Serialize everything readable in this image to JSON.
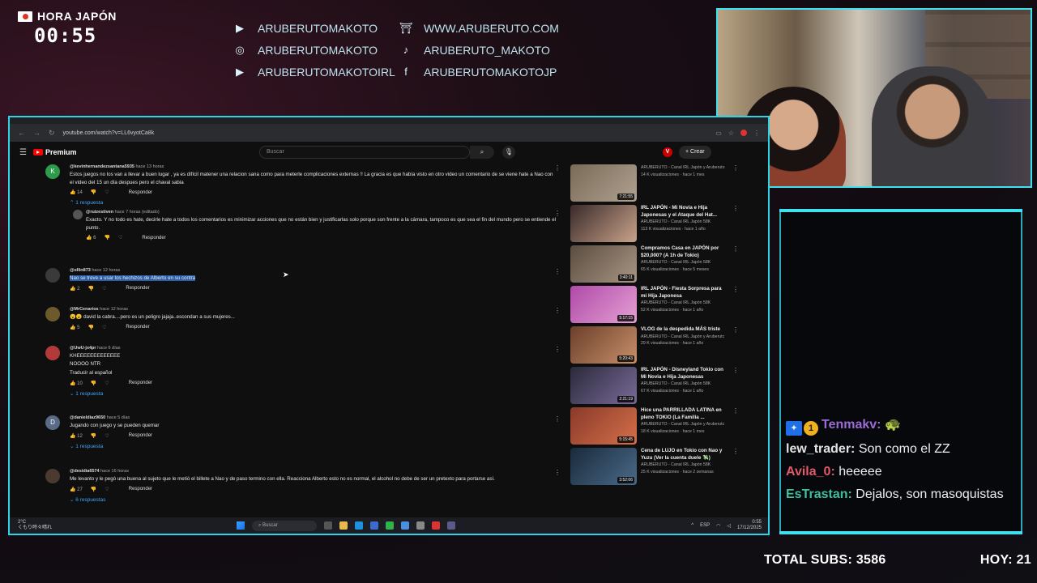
{
  "overlay": {
    "hora_label": "HORA JAPÓN",
    "hora_time": "00:55",
    "socials": [
      {
        "icon": "youtube-icon",
        "glyph": "▶",
        "text": "ARUBERUTOMAKOTO"
      },
      {
        "icon": "torii-icon",
        "glyph": "⛩",
        "text": "WWW.ARUBERUTO.COM"
      },
      {
        "icon": "instagram-icon",
        "glyph": "◎",
        "text": "ARUBERUTOMAKOTO"
      },
      {
        "icon": "tiktok-icon",
        "glyph": "♪",
        "text": "ARUBERUTO_MAKOTO"
      },
      {
        "icon": "youtube-icon",
        "glyph": "▶",
        "text": "ARUBERUTOMAKOTOIRL"
      },
      {
        "icon": "facebook-icon",
        "glyph": "f",
        "text": "ARUBERUTOMAKOTOJP"
      }
    ],
    "stats": {
      "total_subs": "TOTAL SUBS: 3586",
      "hoy": "HOY: 21"
    }
  },
  "chat": [
    {
      "user": "Tenmakv:",
      "color": "#9b6bd6",
      "message": "🐢",
      "badges": true
    },
    {
      "user": "lew_trader:",
      "color": "#e3e3e3",
      "message": "Son como el ZZ",
      "badges": false
    },
    {
      "user": "Avila_0:",
      "color": "#e05a6a",
      "message": "heeeee",
      "badges": false
    },
    {
      "user": "EsTrastan:",
      "color": "#3fbfa0",
      "message": "Dejalos, son masoquistas",
      "badges": false
    }
  ],
  "browser": {
    "url": "youtube.com/watch?v=LL6vyotCa8k"
  },
  "youtube": {
    "logo": "Premium",
    "search_placeholder": "Buscar",
    "create_label": "Crear",
    "v_badge": "V",
    "comments": [
      {
        "author": "@kevinhernandezsantana5935",
        "time": "hace 13 horas",
        "avatar": "K",
        "avatar_color": "#2e9a4c",
        "text": "Estos juegos no los van a llevar a buen lugar , ya es difícil matener una relacion sana como para meterle complicaciones externas !! La gracia es que había visto en otro video un comentario de se viene hate a Nao con el video del 15 un día despues pero el chaval sabia",
        "likes": "14",
        "reply_label": "Responder",
        "replies": "1 respuesta"
      },
      {
        "author": "@ruizestiven",
        "time": "hace 7 horas (editado)",
        "avatar": "",
        "avatar_color": "#555",
        "text": "Exacto. Y no todo es hate, decirle hate a todos los comentarios es minimizar acciones que no están bien y justificarlas solo porque son frente a la cámara, tampoco es que sea el fin del mundo pero se entiende el punto.",
        "likes": "6",
        "reply_label": "Responder",
        "replies": ""
      },
      {
        "author": "@ollin873",
        "time": "hace 12 horas",
        "avatar": "",
        "avatar_color": "#3a3a3a",
        "text": "Nao se treve a usar los hechizos de Alberto en su contra",
        "likes": "2",
        "reply_label": "Responder",
        "replies": ""
      },
      {
        "author": "@MrCenarios",
        "time": "hace 12 horas",
        "avatar": "",
        "avatar_color": "#6d5a2c",
        "text": "😮😮 david la cabra....pero es un peligro jajaja..escondan a sus mujeres...",
        "likes": "5",
        "reply_label": "Responder",
        "replies": ""
      },
      {
        "author": "@UwU-jx4pr",
        "time": "hace 6 días",
        "avatar": "",
        "avatar_color": "#b23a3a",
        "text": "KHEEEEEEEEEEEEE\nNOOOO NTR",
        "translate": "Traducir al español",
        "likes": "10",
        "reply_label": "Responder",
        "replies": "1 respuesta"
      },
      {
        "author": "@danieldiaz9650",
        "time": "hace 5 días",
        "avatar": "D",
        "avatar_color": "#5a6b85",
        "text": "Jugando con juego y se pueden quemar",
        "likes": "12",
        "reply_label": "Responder",
        "replies": "1 respuesta"
      },
      {
        "author": "@desidia6574",
        "time": "hace 16 horas",
        "avatar": "",
        "avatar_color": "#4a3a30",
        "text": "Me levanto y le pegó una buena al sujeto que le metió el billete a Nao y de paso termino con ella. Reacciona Alberto esto no es normal, el alcohol no debe de ser un pretexto para portarse así.",
        "likes": "27",
        "reply_label": "Responder",
        "replies": "6 respuestas"
      }
    ],
    "videos": [
      {
        "title": "",
        "channel": "ARUBERUTO - Canal IRL Japón y Aruberuto",
        "views": "14 K visualizaciones · hace 1 mes",
        "duration": "7:21:55",
        "colors": [
          "#7a6a58",
          "#b0a190"
        ]
      },
      {
        "title": "IRL JAPÓN - Mi Novia e Hija Japonesas y el Ataque del Hat...",
        "channel": "ARUBERUTO - Canal IRL Japón",
        "sub": "58K",
        "views": "113 K visualizaciones · hace 1 año",
        "duration": "",
        "colors": [
          "#3a2a2a",
          "#c9a38a"
        ]
      },
      {
        "title": "Compramos Casa en JAPÓN por $20,000? (A 1h de Tokio)",
        "channel": "ARUBERUTO - Canal IRL Japón",
        "sub": "58K",
        "views": "65 K visualizaciones · hace 5 meses",
        "duration": "3:40:11",
        "colors": [
          "#5a4d40",
          "#a99584"
        ]
      },
      {
        "title": "IRL JAPÓN - Fiesta Sorpresa para mi Hija Japonesa",
        "channel": "ARUBERUTO - Canal IRL Japón",
        "sub": "58K",
        "views": "52 K visualizaciones · hace 1 año",
        "duration": "5:17:15",
        "colors": [
          "#b04aa8",
          "#e4a0d4"
        ]
      },
      {
        "title": "VLOG de la despedida MÁS triste",
        "channel": "ARUBERUTO - Canal IRL Japón y Aruberutc",
        "sub": "",
        "views": "29 K visualizaciones · hace 1 año",
        "duration": "5:20:43",
        "colors": [
          "#6b3f2a",
          "#c8906a"
        ]
      },
      {
        "title": "IRL JAPÓN - Disneyland Tokio con Mi Novia e Hija Japonesas",
        "channel": "ARUBERUTO - Canal IRL Japón",
        "sub": "58K",
        "views": "67 K visualizaciones · hace 1 año",
        "duration": "2:21:19",
        "colors": [
          "#2a2a3a",
          "#7a6a9a"
        ]
      },
      {
        "title": "Hice una PARRILLADA LATINA en pleno TOKIO (La Familia ...",
        "channel": "ARUBERUTO - Canal IRL Japón y Aruberutc",
        "sub": "",
        "views": "18 K visualizaciones · hace 1 mes",
        "duration": "5:15:45",
        "colors": [
          "#8a3a2a",
          "#d4704a"
        ]
      },
      {
        "title": "Cena de LUJO en Tokio con Nao y Yuzu (Ver la cuenta duele 💸)",
        "channel": "ARUBERUTO - Canal IRL Japón",
        "sub": "58K",
        "views": "25 K visualizaciones · hace 2 semanas",
        "duration": "3:52:06",
        "colors": [
          "#1a2a3a",
          "#4a6a8a"
        ]
      }
    ]
  },
  "taskbar": {
    "weather_temp": "2°C",
    "weather_desc": "くもり時々晴れ",
    "search": "Buscar",
    "lang": "ESP",
    "time": "0:55",
    "date": "17/12/2025"
  }
}
